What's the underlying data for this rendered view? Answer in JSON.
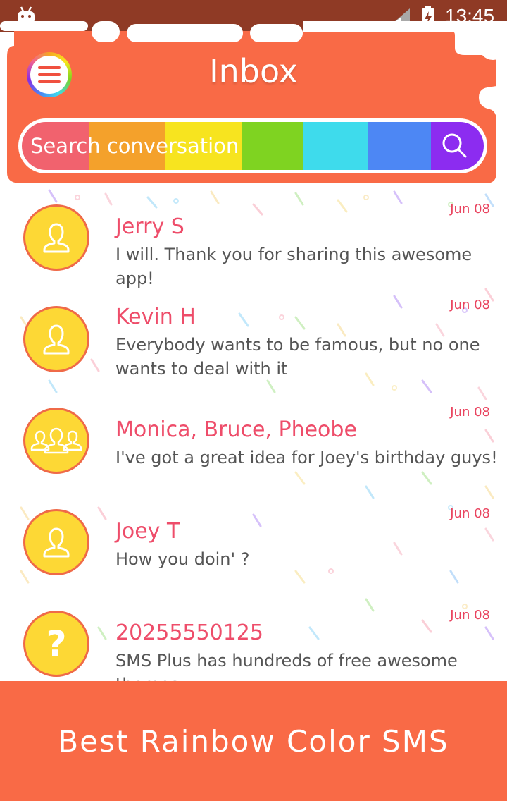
{
  "status_bar": {
    "time": "13:45"
  },
  "header": {
    "title": "Inbox"
  },
  "search": {
    "placeholder": "Search conversation",
    "stripe_colors": [
      "#f1626e",
      "#f4a12b",
      "#f7e41f",
      "#7fd321",
      "#3edbec",
      "#4d87f4",
      "#8c2cf0"
    ]
  },
  "conversations": [
    {
      "name": "Jerry S",
      "snippet": "I will. Thank you for sharing this awesome app!",
      "date": "Jun 08",
      "avatar": "person-icon"
    },
    {
      "name": "Kevin H",
      "snippet": "Everybody wants to be famous, but no one wants to deal with it",
      "date": "Jun 08",
      "avatar": "person-icon"
    },
    {
      "name": "Monica, Bruce, Pheobe",
      "snippet": "I've got a great idea for Joey's birthday guys!",
      "date": "Jun 08",
      "avatar": "group-icon"
    },
    {
      "name": "Joey T",
      "snippet": "How you doin' ?",
      "date": "Jun 08",
      "avatar": "person-icon"
    },
    {
      "name": "20255550125",
      "snippet": "SMS Plus has hundreds of free awesome themes",
      "date": "Jun 08",
      "avatar": "unknown-contact-icon",
      "avatar_glyph": "?"
    }
  ],
  "banner": {
    "text": "Best Rainbow Color SMS"
  },
  "colors": {
    "accent": "#f96a46",
    "name": "#ee4d6a",
    "avatar": "#fdd835",
    "status_bar": "#8f3a25"
  }
}
